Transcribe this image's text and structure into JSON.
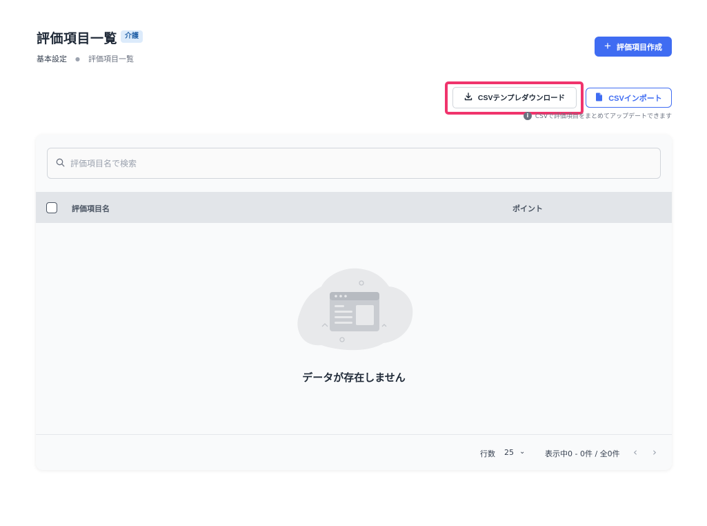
{
  "header": {
    "title": "評価項目一覧",
    "badge": "介護"
  },
  "breadcrumb": {
    "root": "基本設定",
    "current": "評価項目一覧"
  },
  "actions": {
    "create_label": "評価項目作成",
    "template_download_label": "CSVテンプレダウンロード",
    "import_label": "CSVインポート",
    "csv_note": "CSVで評価項目をまとめてアップデートできます"
  },
  "search": {
    "placeholder": "評価項目名で検索"
  },
  "table": {
    "columns": [
      "評価項目名",
      "ポイント"
    ],
    "rows": [],
    "empty_message": "データが存在しません"
  },
  "pagination": {
    "rows_label": "行数",
    "rows_per_page": "25",
    "range_text": "表示中0 - 0件 / 全0件"
  },
  "colors": {
    "primary": "#3f6cf2",
    "highlight": "#f0346c",
    "table_header": "#e2e5e9"
  }
}
